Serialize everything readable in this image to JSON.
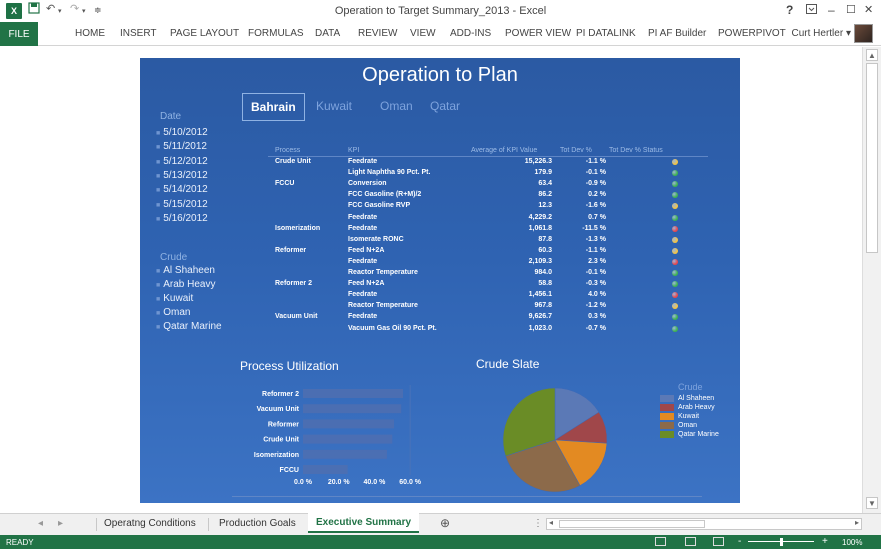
{
  "window": {
    "title": "Operation to Target Summary_2013 - Excel",
    "help": "?",
    "minimize": "–",
    "restore": "☐",
    "close": "✕"
  },
  "ribbon": {
    "file": "FILE",
    "tabs": [
      "HOME",
      "INSERT",
      "PAGE LAYOUT",
      "FORMULAS",
      "DATA",
      "REVIEW",
      "VIEW",
      "ADD-INS",
      "POWER VIEW",
      "PI DATALINK",
      "PI AF Builder",
      "POWERPIVOT"
    ],
    "user": "Curt Hertler"
  },
  "dashboard": {
    "title": "Operation to Plan",
    "date_label": "Date",
    "dates": [
      "5/10/2012",
      "5/11/2012",
      "5/12/2012",
      "5/13/2012",
      "5/14/2012",
      "5/15/2012",
      "5/16/2012"
    ],
    "crude_label": "Crude",
    "crudes": [
      "Al Shaheen",
      "Arab Heavy",
      "Kuwait",
      "Oman",
      "Qatar Marine"
    ],
    "countries": [
      "Bahrain",
      "Kuwait",
      "Oman",
      "Qatar"
    ],
    "selected_country": "Bahrain",
    "kpi_headers": [
      "Process",
      "KPI",
      "Average of KPI Value",
      "Tot Dev %",
      "Tot Dev % Status"
    ],
    "kpi_rows": [
      {
        "process": "Crude Unit",
        "kpi": "Feedrate",
        "value": "15,226.3",
        "dev": "-1.1 %",
        "status": "#f5c542"
      },
      {
        "process": "",
        "kpi": "Light Naphtha 90 Pct. Pt.",
        "value": "179.9",
        "dev": "-0.1 %",
        "status": "#3fb34f"
      },
      {
        "process": "FCCU",
        "kpi": "Conversion",
        "value": "63.4",
        "dev": "-0.9 %",
        "status": "#3fb34f"
      },
      {
        "process": "",
        "kpi": "FCC Gasoline (R+M)/2",
        "value": "86.2",
        "dev": "0.2 %",
        "status": "#3fb34f"
      },
      {
        "process": "",
        "kpi": "FCC Gasoline RVP",
        "value": "12.3",
        "dev": "-1.6 %",
        "status": "#f5c542"
      },
      {
        "process": "",
        "kpi": "Feedrate",
        "value": "4,229.2",
        "dev": "0.7 %",
        "status": "#3fb34f"
      },
      {
        "process": "Isomerization",
        "kpi": "Feedrate",
        "value": "1,061.8",
        "dev": "-11.5 %",
        "status": "#e8474c"
      },
      {
        "process": "",
        "kpi": "Isomerate RONC",
        "value": "87.8",
        "dev": "-1.3 %",
        "status": "#f5c542"
      },
      {
        "process": "Reformer",
        "kpi": "Feed N+2A",
        "value": "60.3",
        "dev": "-1.1 %",
        "status": "#f5c542"
      },
      {
        "process": "",
        "kpi": "Feedrate",
        "value": "2,109.3",
        "dev": "2.3 %",
        "status": "#e8474c"
      },
      {
        "process": "",
        "kpi": "Reactor Temperature",
        "value": "984.0",
        "dev": "-0.1 %",
        "status": "#3fb34f"
      },
      {
        "process": "Reformer 2",
        "kpi": "Feed N+2A",
        "value": "58.8",
        "dev": "-0.3 %",
        "status": "#3fb34f"
      },
      {
        "process": "",
        "kpi": "Feedrate",
        "value": "1,456.1",
        "dev": "4.0 %",
        "status": "#e8474c"
      },
      {
        "process": "",
        "kpi": "Reactor Temperature",
        "value": "967.8",
        "dev": "-1.2 %",
        "status": "#f5c542"
      },
      {
        "process": "Vacuum Unit",
        "kpi": "Feedrate",
        "value": "9,626.7",
        "dev": "0.3 %",
        "status": "#3fb34f"
      },
      {
        "process": "",
        "kpi": "Vacuum Gas Oil 90 Pct. Pt.",
        "value": "1,023.0",
        "dev": "-0.7 %",
        "status": "#3fb34f"
      }
    ],
    "util_title": "Process Utilization",
    "crude_slate_title": "Crude Slate",
    "legend_title": "Crude"
  },
  "chart_data": [
    {
      "type": "bar",
      "orientation": "horizontal",
      "title": "Process Utilization",
      "categories": [
        "Reformer 2",
        "Vacuum Unit",
        "Reformer",
        "Crude Unit",
        "Isomerization",
        "FCCU"
      ],
      "values": [
        0.56,
        0.55,
        0.51,
        0.5,
        0.47,
        0.25
      ],
      "xlim": [
        0,
        0.7
      ],
      "tick_labels": [
        "0.0 %",
        "20.0 %",
        "40.0 %",
        "60.0 %"
      ],
      "color": "#4f6fb0"
    },
    {
      "type": "pie",
      "title": "Crude Slate",
      "legend_title": "Crude",
      "legend_position": "right",
      "series": [
        {
          "name": "Al Shaheen",
          "value": 0.16,
          "color": "#5b79b6"
        },
        {
          "name": "Arab Heavy",
          "value": 0.1,
          "color": "#a0474a"
        },
        {
          "name": "Kuwait",
          "value": 0.16,
          "color": "#e38a22"
        },
        {
          "name": "Oman",
          "value": 0.28,
          "color": "#8c6a4a"
        },
        {
          "name": "Qatar Marine",
          "value": 0.3,
          "color": "#6a8c26"
        }
      ]
    }
  ],
  "sheet_tabs": {
    "tabs": [
      "Operatng Conditions",
      "Production Goals",
      "Executive Summary"
    ],
    "active": "Executive Summary",
    "add": "⊕"
  },
  "status": {
    "text": "READY",
    "zoom_minus": "-",
    "zoom_plus": "+",
    "zoom": "100%"
  }
}
